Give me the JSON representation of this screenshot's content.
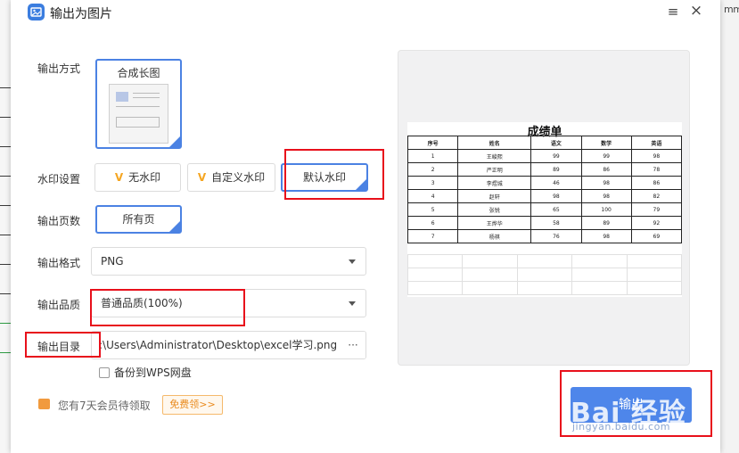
{
  "window": {
    "title": "输出为图片",
    "menu_icon": "≡",
    "close_icon": "×"
  },
  "background": {
    "right_edge_text": "mme"
  },
  "output_mode": {
    "label": "输出方式",
    "option": "合成长图"
  },
  "watermark": {
    "label": "水印设置",
    "options": [
      {
        "label": "无水印",
        "icon": "V"
      },
      {
        "label": "自定义水印",
        "icon": "V"
      },
      {
        "label": "默认水印"
      }
    ],
    "selected": "默认水印"
  },
  "pages": {
    "label": "输出页数",
    "option": "所有页"
  },
  "format": {
    "label": "输出格式",
    "value": "PNG"
  },
  "quality": {
    "label": "输出品质",
    "value": "普通品质(100%)"
  },
  "directory": {
    "label": "输出目录",
    "value": ":\\Users\\Administrator\\Desktop\\excel学习.png",
    "browse": "···"
  },
  "backup": {
    "label": "备份到WPS网盘",
    "checked": false
  },
  "promo": {
    "text": "您有7天会员待领取",
    "button": "免费领>>"
  },
  "export_button": {
    "label": "输出"
  },
  "watermark_overlay": {
    "text": "Bai 经验",
    "url": "jingyan.baidu.com"
  },
  "preview": {
    "title": "成绩单",
    "headers": [
      "序号",
      "姓名",
      "语文",
      "数学",
      "英语"
    ],
    "rows": [
      [
        "1",
        "王峻熙",
        "99",
        "99",
        "98"
      ],
      [
        "2",
        "严正明",
        "89",
        "86",
        "78"
      ],
      [
        "3",
        "李煜城",
        "46",
        "98",
        "86"
      ],
      [
        "4",
        "赵轩",
        "98",
        "98",
        "82"
      ],
      [
        "5",
        "张锐",
        "65",
        "100",
        "79"
      ],
      [
        "6",
        "王烨华",
        "58",
        "89",
        "92"
      ],
      [
        "7",
        "杨祺",
        "76",
        "98",
        "69"
      ]
    ]
  },
  "colors": {
    "accent": "#4b82e3",
    "highlight": "#e8101b",
    "promo": "#e98a1d"
  }
}
